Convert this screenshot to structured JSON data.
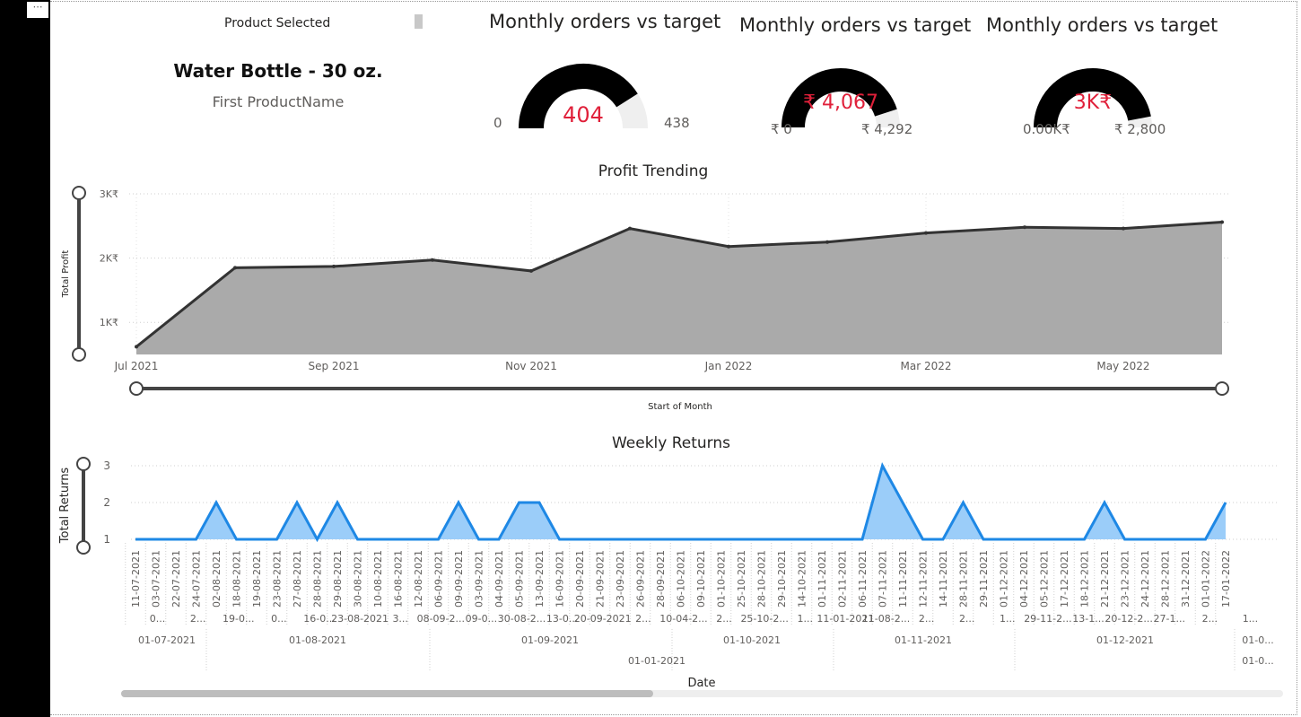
{
  "card": {
    "header": "Product Selected",
    "product_name": "Water Bottle - 30 oz.",
    "caption": "First ProductName"
  },
  "gauges": [
    {
      "title": "Monthly orders vs target",
      "value": "404",
      "min": "0",
      "max": "438",
      "fill": 0.82
    },
    {
      "title": "Monthly orders vs target",
      "value": "₹ 4,067",
      "min": "₹ 0",
      "max": "₹ 4,292",
      "fill": 0.9
    },
    {
      "title": "Monthly orders vs target",
      "value": "3K₹",
      "min": "0.00K₹",
      "max": "₹ 2,800",
      "fill": 0.94
    }
  ],
  "profit": {
    "title": "Profit Trending",
    "ylabel": "Total Profit",
    "xlabel": "Start of Month",
    "yticks": [
      "3K₹",
      "2K₹",
      "1K₹"
    ],
    "xticks": [
      "Jul 2021",
      "Sep 2021",
      "Nov 2021",
      "Jan 2022",
      "Mar 2022",
      "May 2022"
    ]
  },
  "returns": {
    "title": "Weekly Returns",
    "ylabel": "Total Returns",
    "xlabel": "Date",
    "yticks": [
      "3",
      "2",
      "1"
    ],
    "date_ticks": [
      "11-07-2021",
      "03-07-2021",
      "22-07-2021",
      "24-07-2021",
      "02-08-2021",
      "18-08-2021",
      "19-08-2021",
      "23-08-2021",
      "27-08-2021",
      "28-08-2021",
      "29-08-2021",
      "30-08-2021",
      "10-08-2021",
      "16-08-2021",
      "12-08-2021",
      "06-09-2021",
      "09-09-2021",
      "03-09-2021",
      "04-09-2021",
      "05-09-2021",
      "13-09-2021",
      "16-09-2021",
      "20-09-2021",
      "21-09-2021",
      "23-09-2021",
      "26-09-2021",
      "28-09-2021",
      "06-10-2021",
      "09-10-2021",
      "01-10-2021",
      "25-10-2021",
      "28-10-2021",
      "29-10-2021",
      "14-10-2021",
      "01-11-2021",
      "02-11-2021",
      "06-11-2021",
      "07-11-2021",
      "11-11-2021",
      "12-11-2021",
      "14-11-2021",
      "28-11-2021",
      "29-11-2021",
      "01-12-2021",
      "04-12-2021",
      "05-12-2021",
      "17-12-2021",
      "18-12-2021",
      "21-12-2021",
      "23-12-2021",
      "24-12-2021",
      "28-12-2021",
      "31-12-2021",
      "01-01-2022",
      "17-01-2022"
    ],
    "week_labels": [
      "0...",
      "2...",
      "19-0...",
      "0...",
      "16-0...",
      "23-08-2021",
      "3...",
      "08-09-2...",
      "09-0...",
      "30-08-2...",
      "13-0...",
      "20-09-2021",
      "2...",
      "10-04-2...",
      "2...",
      "25-10-2...",
      "1...",
      "11-01-2021",
      "11-08-2...",
      "2...",
      "2...",
      "1...",
      "29-11-2...",
      "13-1...",
      "20-12-2...",
      "27-1...",
      "2...",
      "1..."
    ],
    "month_labels": [
      "01-07-2021",
      "01-08-2021",
      "01-09-2021",
      "01-10-2021",
      "01-11-2021",
      "01-12-2021",
      "01-0..."
    ],
    "year_labels": [
      "01-01-2021",
      "01-0..."
    ]
  },
  "chart_data": [
    {
      "type": "area",
      "title": "Profit Trending",
      "xlabel": "Start of Month",
      "ylabel": "Total Profit",
      "x": [
        "Jul 2021",
        "Aug 2021",
        "Sep 2021",
        "Oct 2021",
        "Nov 2021",
        "Dec 2021",
        "Jan 2022",
        "Feb 2022",
        "Mar 2022",
        "Apr 2022",
        "May 2022",
        "Jun 2022"
      ],
      "values": [
        620,
        1850,
        1870,
        1970,
        1800,
        2460,
        2180,
        2250,
        2390,
        2480,
        2460,
        2560
      ],
      "ylim": [
        500,
        3000
      ],
      "color": "#aaaaaa",
      "line_color": "#333333"
    },
    {
      "type": "area",
      "title": "Weekly Returns",
      "xlabel": "Date",
      "ylabel": "Total Returns",
      "values": [
        1,
        1,
        1,
        1,
        2,
        1,
        1,
        1,
        2,
        1,
        2,
        1,
        1,
        1,
        1,
        1,
        2,
        1,
        1,
        2,
        2,
        1,
        1,
        1,
        1,
        1,
        1,
        1,
        1,
        1,
        1,
        1,
        1,
        1,
        1,
        1,
        1,
        3,
        2,
        1,
        1,
        2,
        1,
        1,
        1,
        1,
        1,
        1,
        2,
        1,
        1,
        1,
        1,
        1,
        2
      ],
      "ylim": [
        1,
        3
      ],
      "color": "#9bcdf9",
      "line_color": "#1e88e5"
    }
  ]
}
